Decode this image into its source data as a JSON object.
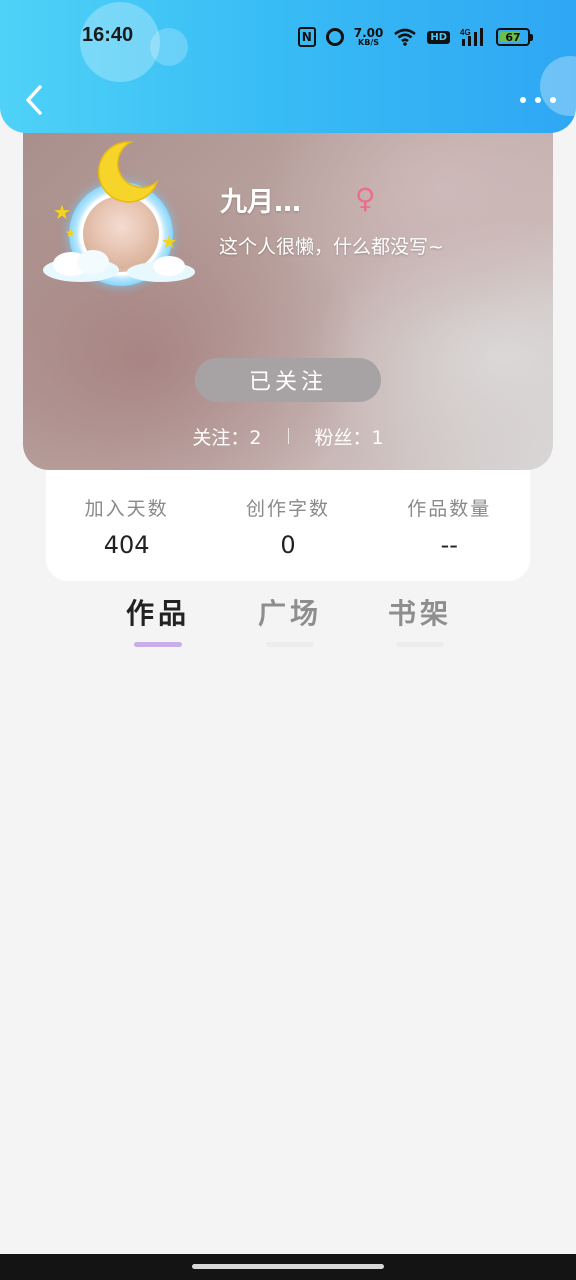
{
  "status_bar": {
    "time": "16:40",
    "nfc_label": "N",
    "speed_value": "7.00",
    "speed_unit": "KB/S",
    "hd_label": "HD",
    "network_label": "4G",
    "battery_level": "67"
  },
  "profile": {
    "username": "九月…",
    "gender_symbol": "♀",
    "bio": "这个人很懒，什么都没写~",
    "follow_button_label": "已关注",
    "following_text": "关注：2",
    "followers_text": "粉丝：1"
  },
  "stats": [
    {
      "label": "加入天数",
      "value": "404"
    },
    {
      "label": "创作字数",
      "value": "0"
    },
    {
      "label": "作品数量",
      "value": "--"
    }
  ],
  "tabs": [
    {
      "label": "作品",
      "active": true
    },
    {
      "label": "广场",
      "active": false
    },
    {
      "label": "书架",
      "active": false
    }
  ],
  "colors": {
    "header_start": "#4fd2f7",
    "header_end": "#2fa7f4",
    "active_tab_underline": "#c9aee8",
    "gender_pink": "#e96f8c",
    "follow_button": "#a7a3a5",
    "battery_fill": "#6cc04a"
  },
  "icons": {
    "back": "chevron-left-icon",
    "more": "more-dots-icon",
    "gender": "female-icon",
    "avatar_frame": "moon-cloud-frame"
  }
}
